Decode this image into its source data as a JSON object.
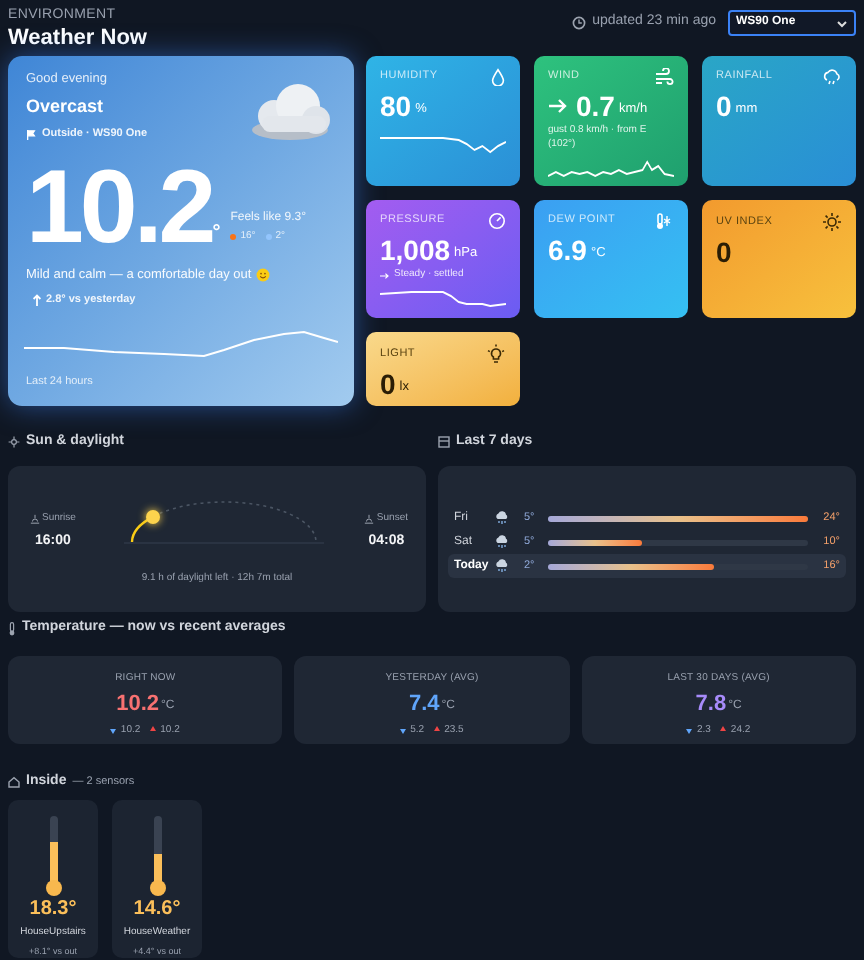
{
  "header": {
    "eyebrow": "ENVIRONMENT",
    "title": "Weather Now",
    "updated": "updated 23 min ago",
    "station_select": {
      "value": "WS90 One"
    }
  },
  "hero": {
    "greeting": "Good evening",
    "condition": "Overcast",
    "location": "Outside · WS90 One",
    "temperature": "10.2",
    "degree": "°",
    "feels_like": "Feels like 9.3°",
    "high": "16°",
    "low": "2°",
    "summary": "Mild and calm — a comfortable day out",
    "delta": "2.8° vs yesterday",
    "chart_label": "Last 24 hours"
  },
  "tiles": [
    {
      "kind": "humidity",
      "label": "HUMIDITY",
      "value": "80",
      "unit": "%"
    },
    {
      "kind": "wind",
      "label": "WIND",
      "value": "0.7",
      "unit": "km/h",
      "detail": "gust 0.8 km/h · from E (102°)"
    },
    {
      "kind": "rain",
      "label": "RAINFALL",
      "value": "0",
      "unit": "mm"
    },
    {
      "kind": "pressure",
      "label": "PRESSURE",
      "value": "1,008",
      "unit": "hPa",
      "detail": "Steady · settled"
    },
    {
      "kind": "dewpoint",
      "label": "DEW POINT",
      "value": "6.9",
      "unit": "°C"
    },
    {
      "kind": "uv",
      "label": "UV INDEX",
      "value": "0"
    },
    {
      "kind": "light",
      "label": "LIGHT",
      "value": "0",
      "unit": "lx"
    }
  ],
  "sun": {
    "title": "Sun & daylight",
    "sunrise_label": "Sunrise",
    "sunrise": "16:00",
    "sunset_label": "Sunset",
    "sunset": "04:08",
    "caption": "9.1 h of daylight left · 12h 7m total"
  },
  "week": {
    "title": "Last 7 days",
    "days": [
      {
        "day": "Fri",
        "low": "5°",
        "high": "24°",
        "level": 1.0,
        "selected": false
      },
      {
        "day": "Sat",
        "low": "5°",
        "high": "10°",
        "level": 0.36,
        "selected": false
      },
      {
        "day": "Today",
        "low": "2°",
        "high": "16°",
        "level": 0.64,
        "selected": true
      }
    ]
  },
  "temperature": {
    "title": "Temperature — now vs recent averages",
    "cards": [
      {
        "label": "RIGHT NOW",
        "value": "10.2",
        "unit": "°C",
        "color": "#f87171",
        "low": "10.2",
        "high": "10.2"
      },
      {
        "label": "YESTERDAY (AVG)",
        "value": "7.4",
        "unit": "°C",
        "color": "#60a5fa",
        "low": "5.2",
        "high": "23.5"
      },
      {
        "label": "LAST 30 DAYS (AVG)",
        "value": "7.8",
        "unit": "°C",
        "color": "#a78bfa",
        "low": "2.3",
        "high": "24.2"
      }
    ]
  },
  "inside": {
    "title": "Inside",
    "subtitle": "— 2 sensors",
    "sensors": [
      {
        "value": "18.3°",
        "name": "HouseUpstairs",
        "delta": "+8.1° vs out",
        "level": 0.62
      },
      {
        "value": "14.6°",
        "name": "HouseWeather",
        "delta": "+4.4° vs out",
        "level": 0.45
      }
    ]
  }
}
